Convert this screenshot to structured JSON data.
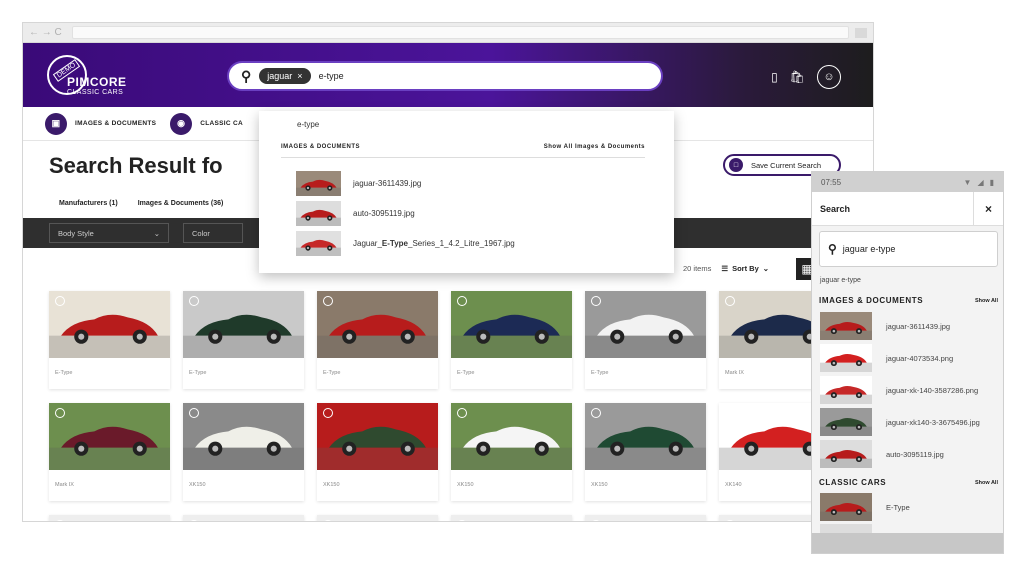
{
  "browser": {
    "nav_glyphs": "← → C"
  },
  "header": {
    "logo_badge": "DEMO",
    "logo_name": "PIMCORE",
    "logo_sub": "CLASSIC CARS",
    "search": {
      "chip_label": "jaguar",
      "chip_remove": "×",
      "query": "e-type"
    }
  },
  "categories": [
    {
      "label": "IMAGES & DOCUMENTS",
      "icon": "image-icon"
    },
    {
      "label": "CLASSIC CA",
      "icon": "car-icon"
    }
  ],
  "main": {
    "title": "Search Result fo",
    "save_label": "Save Current Search",
    "tabs": [
      {
        "label": "Manufacturers (1)"
      },
      {
        "label": "Images & Documents (36)"
      }
    ],
    "filters": [
      {
        "label": "Body Style"
      },
      {
        "label": "Color"
      }
    ],
    "count": "20 items",
    "sort_label": "Sort By"
  },
  "results": [
    {
      "label": "E-Type",
      "colors": [
        "#b71c1c",
        "#e8e2d6"
      ]
    },
    {
      "label": "E-Type",
      "colors": [
        "#1f3a2a",
        "#c9c9c9"
      ]
    },
    {
      "label": "E-Type",
      "colors": [
        "#b71c1c",
        "#8a7a6a"
      ]
    },
    {
      "label": "E-Type",
      "colors": [
        "#1c2a55",
        "#6d8f4e"
      ]
    },
    {
      "label": "E-Type",
      "colors": [
        "#f2f2f2",
        "#9a9a9a"
      ]
    },
    {
      "label": "Mark IX",
      "colors": [
        "#1c2a4a",
        "#d9d4c9"
      ]
    },
    {
      "label": "Mark IX",
      "colors": [
        "#6a1a2a",
        "#6d8f4e"
      ]
    },
    {
      "label": "XK150",
      "colors": [
        "#efefe8",
        "#8a8a8a"
      ]
    },
    {
      "label": "XK150",
      "colors": [
        "#2f4a2f",
        "#b71c1c"
      ]
    },
    {
      "label": "XK150",
      "colors": [
        "#f5f5f5",
        "#6d8f4e"
      ]
    },
    {
      "label": "XK150",
      "colors": [
        "#1f4a33",
        "#9a9a9a"
      ]
    },
    {
      "label": "XK140",
      "colors": [
        "#d32020",
        "#ffffff"
      ]
    },
    {
      "label": "",
      "colors": [
        "#c9b99a",
        "#eeeeee"
      ]
    },
    {
      "label": "",
      "colors": [
        "#6a6a6a",
        "#eeeeee"
      ]
    },
    {
      "label": "",
      "colors": [
        "#9a8a7a",
        "#eeeeee"
      ]
    },
    {
      "label": "",
      "colors": [
        "#7a9a6a",
        "#eeeeee"
      ]
    },
    {
      "label": "",
      "colors": [
        "#555555",
        "#eeeeee"
      ]
    },
    {
      "label": "",
      "colors": [
        "#cc3333",
        "#eeeeee"
      ]
    }
  ],
  "dropdown": {
    "suggestion": "e-type",
    "section_title": "IMAGES & DOCUMENTS",
    "section_link": "Show All Images & Documents",
    "items": [
      {
        "name": "jaguar-3611439.jpg",
        "colors": [
          "#b71c1c",
          "#9a8a7a"
        ]
      },
      {
        "name": "auto-3095119.jpg",
        "colors": [
          "#b71c1c",
          "#dddddd"
        ]
      },
      {
        "prefix": "Jaguar_",
        "bold": "E-Type",
        "suffix": "_Series_1_4.2_Litre_1967.jpg",
        "colors": [
          "#c62828",
          "#e0e0e0"
        ]
      }
    ]
  },
  "phone": {
    "time": "07:55",
    "title": "Search",
    "close": "×",
    "query": "jaguar e-type",
    "suggestion": "jaguar e-type",
    "images_title": "IMAGES & DOCUMENTS",
    "images_link": "Show All",
    "images": [
      {
        "name": "jaguar-3611439.jpg",
        "colors": [
          "#b71c1c",
          "#9a8a7a"
        ]
      },
      {
        "name": "jaguar-4073534.png",
        "colors": [
          "#d32020",
          "#ffffff"
        ]
      },
      {
        "name": "jaguar-xk-140-3587286.png",
        "colors": [
          "#c62828",
          "#ffffff"
        ]
      },
      {
        "name": "jaguar-xk140-3-3675496.jpg",
        "colors": [
          "#2f4a2f",
          "#9a9a9a"
        ]
      },
      {
        "name": "auto-3095119.jpg",
        "colors": [
          "#b71c1c",
          "#dddddd"
        ]
      }
    ],
    "cars_title": "CLASSIC CARS",
    "cars_link": "Show All",
    "cars": [
      {
        "name": "E-Type",
        "colors": [
          "#b71c1c",
          "#8a7a6a"
        ]
      },
      {
        "name": "",
        "colors": [
          "#b71c1c",
          "#dddddd"
        ]
      }
    ]
  }
}
